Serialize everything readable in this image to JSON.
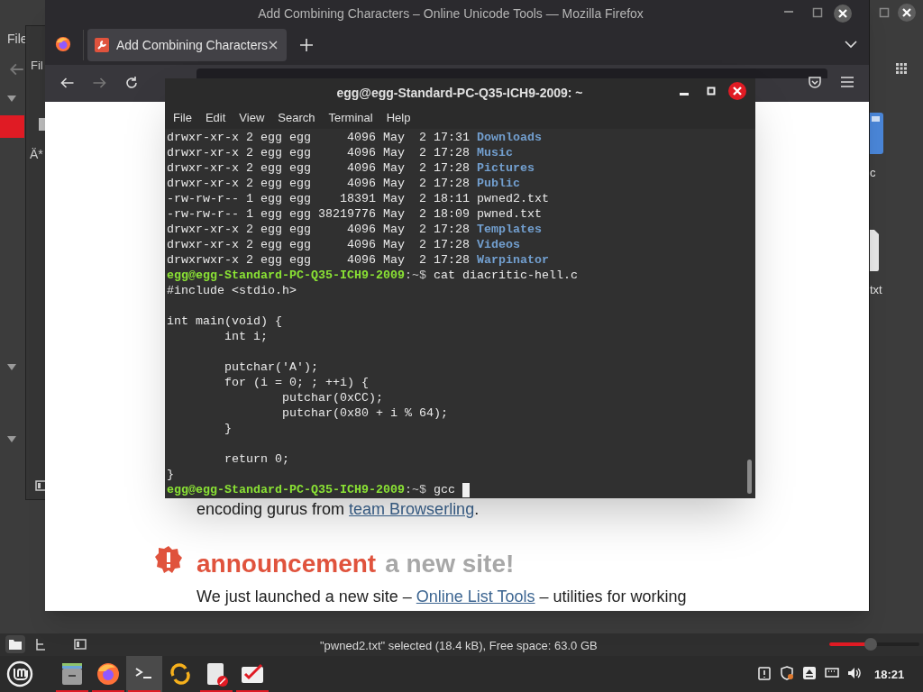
{
  "file_manager": {
    "menu": [
      "File"
    ],
    "items": [
      {
        "label": "c",
        "kind": "folder"
      },
      {
        "label": "txt",
        "kind": "file"
      }
    ],
    "status": "\"pwned2.txt\" selected (18.4 kB), Free space: 63.0 GB",
    "zoom": {
      "level": 0.45
    }
  },
  "back_window": {
    "menu": [
      "Fil"
    ],
    "text": "Ä*"
  },
  "browser": {
    "title": "Add Combining Characters – Online Unicode Tools — Mozilla Firefox",
    "tabs": [
      {
        "label": "Add Combining Characters",
        "selected": true
      }
    ],
    "forward_disabled": true,
    "page": {
      "intro": "encoding gurus from ",
      "intro_link": "team Browserling",
      "intro_end": ".",
      "heading": "announcement",
      "heading_rest": "a new site!",
      "para": "We just launched a new site – ",
      "para_link": "Online List Tools",
      "para_end": " – utilities for working"
    }
  },
  "terminal": {
    "title": "egg@egg-Standard-PC-Q35-ICH9-2009: ~",
    "menu": [
      "File",
      "Edit",
      "View",
      "Search",
      "Terminal",
      "Help"
    ],
    "lines": [
      {
        "kind": "listing",
        "info": "drwxr-xr-x 2 egg egg     4096 May  2 17:31",
        "name": "Downloads",
        "directory": true
      },
      {
        "kind": "listing",
        "info": "drwxr-xr-x 2 egg egg     4096 May  2 17:28",
        "name": "Music",
        "directory": true
      },
      {
        "kind": "listing",
        "info": "drwxr-xr-x 2 egg egg     4096 May  2 17:28",
        "name": "Pictures",
        "directory": true
      },
      {
        "kind": "listing",
        "info": "drwxr-xr-x 2 egg egg     4096 May  2 17:28",
        "name": "Public",
        "directory": true
      },
      {
        "kind": "listing",
        "info": "-rw-rw-r-- 1 egg egg    18391 May  2 18:11",
        "name": "pwned2.txt",
        "directory": false
      },
      {
        "kind": "listing",
        "info": "-rw-rw-r-- 1 egg egg 38219776 May  2 18:09",
        "name": "pwned.txt",
        "directory": false
      },
      {
        "kind": "listing",
        "info": "drwxr-xr-x 2 egg egg     4096 May  2 17:28",
        "name": "Templates",
        "directory": true
      },
      {
        "kind": "listing",
        "info": "drwxr-xr-x 2 egg egg     4096 May  2 17:28",
        "name": "Videos",
        "directory": true
      },
      {
        "kind": "listing",
        "info": "drwxrwxr-x 2 egg egg     4096 May  2 17:28",
        "name": "Warpinator",
        "directory": true
      },
      {
        "kind": "prompt",
        "user_host": "egg@egg-Standard-PC-Q35-ICH9-2009",
        "path": ":~$",
        "command": "cat diacritic-hell.c",
        "cursor": false
      },
      {
        "kind": "code",
        "text": "#include <stdio.h>"
      },
      {
        "kind": "blank"
      },
      {
        "kind": "code",
        "text": "int main(void) {"
      },
      {
        "kind": "code",
        "text": "        int i;"
      },
      {
        "kind": "blank"
      },
      {
        "kind": "code",
        "text": "        putchar('A');"
      },
      {
        "kind": "code",
        "text": "        for (i = 0; ; ++i) {"
      },
      {
        "kind": "code",
        "text": "                putchar(0xCC);"
      },
      {
        "kind": "code",
        "text": "                putchar(0x80 + i % 64);"
      },
      {
        "kind": "code",
        "text": "        }"
      },
      {
        "kind": "blank"
      },
      {
        "kind": "code",
        "text": "        return 0;"
      },
      {
        "kind": "code",
        "text": "}"
      },
      {
        "kind": "prompt",
        "user_host": "egg@egg-Standard-PC-Q35-ICH9-2009",
        "path": ":~$",
        "command": "gcc",
        "cursor": true
      }
    ]
  },
  "taskbar": {
    "launchers": [
      {
        "kind": "files",
        "running": true,
        "active": false
      },
      {
        "kind": "firefox",
        "running": true,
        "active": false
      },
      {
        "kind": "terminal",
        "running": true,
        "active": true
      },
      {
        "kind": "sync",
        "running": false,
        "active": false
      },
      {
        "kind": "document",
        "running": true,
        "active": false
      },
      {
        "kind": "checklist",
        "running": true,
        "active": false
      }
    ],
    "tray": [
      {
        "kind": "clipboard"
      },
      {
        "kind": "shield"
      },
      {
        "kind": "eject"
      },
      {
        "kind": "network"
      },
      {
        "kind": "volume"
      }
    ],
    "clock": "18:21"
  }
}
